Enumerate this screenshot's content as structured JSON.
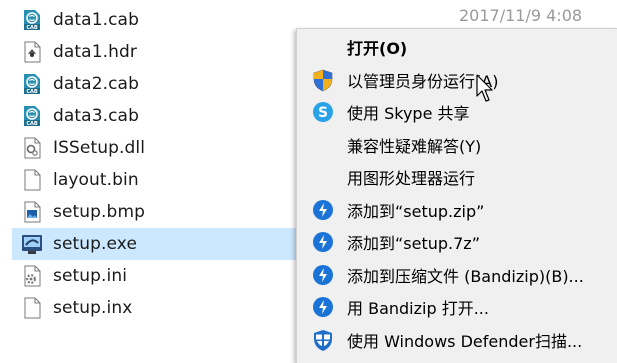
{
  "files": [
    {
      "name": "data1.cab",
      "icon": "cab-archive-icon",
      "selected": false
    },
    {
      "name": "data1.hdr",
      "icon": "hdr-file-icon",
      "selected": false
    },
    {
      "name": "data2.cab",
      "icon": "cab-archive-icon",
      "selected": false
    },
    {
      "name": "data3.cab",
      "icon": "cab-archive-icon",
      "selected": false
    },
    {
      "name": "ISSetup.dll",
      "icon": "dll-file-icon",
      "selected": false
    },
    {
      "name": "layout.bin",
      "icon": "blank-file-icon",
      "selected": false
    },
    {
      "name": "setup.bmp",
      "icon": "bitmap-image-icon",
      "selected": false
    },
    {
      "name": "setup.exe",
      "icon": "installer-exe-icon",
      "selected": true
    },
    {
      "name": "setup.ini",
      "icon": "ini-settings-icon",
      "selected": false
    },
    {
      "name": "setup.inx",
      "icon": "blank-file-icon",
      "selected": false
    }
  ],
  "date_modified": "2017/11/9 4:08",
  "menu": {
    "items": [
      {
        "label": "打开(O)",
        "icon": "",
        "bold": true
      },
      {
        "label": "以管理员身份运行(A)",
        "icon": "uac-shield-icon",
        "bold": false
      },
      {
        "label": "使用 Skype 共享",
        "icon": "skype-icon",
        "bold": false
      },
      {
        "label": "兼容性疑难解答(Y)",
        "icon": "",
        "bold": false
      },
      {
        "label": "用图形处理器运行",
        "icon": "",
        "bold": false
      },
      {
        "label": "添加到“setup.zip”",
        "icon": "bandizip-icon",
        "bold": false
      },
      {
        "label": "添加到“setup.7z”",
        "icon": "bandizip-icon",
        "bold": false
      },
      {
        "label": "添加到压缩文件 (Bandizip)(B)...",
        "icon": "bandizip-icon",
        "bold": false
      },
      {
        "label": "用 Bandizip 打开...",
        "icon": "bandizip-icon",
        "bold": false
      },
      {
        "label": "使用 Windows Defender扫描...",
        "icon": "windows-defender-icon",
        "bold": false
      }
    ]
  },
  "colors": {
    "selection": "#cce8ff",
    "menu_bg": "#f0f0f0",
    "bandizip_blue": "#1a73d6",
    "skype_blue": "#2aa2e8",
    "cab_teal": "#2a8fb0"
  }
}
